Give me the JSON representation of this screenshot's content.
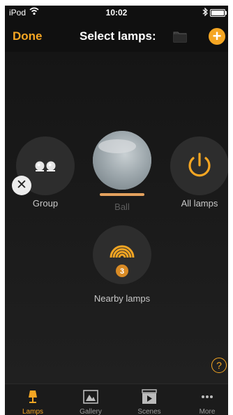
{
  "status": {
    "carrier": "iPod",
    "time": "10:02"
  },
  "nav": {
    "done_label": "Done",
    "title": "Select lamps:",
    "add_label": "+"
  },
  "tiles": {
    "group_label": "Group",
    "ball_label": "Ball",
    "all_label": "All lamps",
    "nearby_label": "Nearby lamps",
    "nearby_count": "3",
    "close_glyph": "✕"
  },
  "help_glyph": "?",
  "tabs": [
    {
      "label": "Lamps",
      "icon": "lamp-icon"
    },
    {
      "label": "Gallery",
      "icon": "gallery-icon"
    },
    {
      "label": "Scenes",
      "icon": "scenes-icon"
    },
    {
      "label": "More",
      "icon": "more-icon"
    }
  ],
  "colors": {
    "accent": "#f5a623",
    "background": "#151515",
    "tile": "#2d2d2d"
  }
}
